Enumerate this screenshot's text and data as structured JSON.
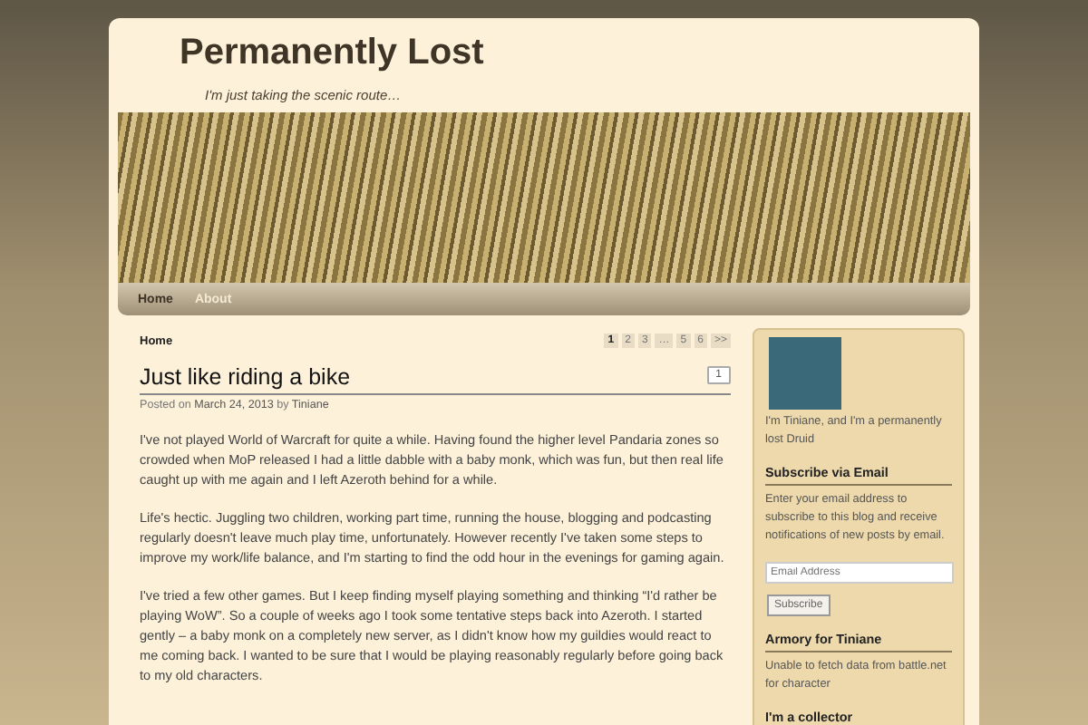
{
  "site": {
    "title": "Permanently Lost",
    "tagline": "I'm just taking the scenic route…"
  },
  "nav": [
    {
      "label": "Home",
      "selected": true
    },
    {
      "label": "About",
      "selected": false
    }
  ],
  "breadcrumb": "Home",
  "pagination": [
    {
      "label": "1",
      "selected": true
    },
    {
      "label": "2",
      "selected": false
    },
    {
      "label": "3",
      "selected": false
    },
    {
      "label": "…",
      "selected": false
    },
    {
      "label": "5",
      "selected": false
    },
    {
      "label": "6",
      "selected": false
    },
    {
      "label": ">>",
      "selected": false
    }
  ],
  "post": {
    "title": "Just like riding a bike",
    "comments": "1",
    "posted_prefix": "Posted on",
    "date": "March 24, 2013",
    "by": "by",
    "author": "Tiniane",
    "paragraphs": [
      "I've not played World of Warcraft for quite a while. Having found the higher level Pandaria zones so crowded when MoP released I had a little dabble with a baby monk, which was fun, but then real life caught up with me again and I left Azeroth behind for a while.",
      "Life's hectic. Juggling two children, working part time, running the house, blogging and podcasting regularly doesn't leave much play time, unfortunately. However recently I've taken some steps to improve my work/life balance, and I'm starting to find the odd hour in the evenings for gaming again.",
      "I've tried a few other games. But I keep finding myself playing something and thinking “I'd rather be playing WoW”. So a couple of weeks ago I took some tentative steps back into Azeroth. I started gently – a baby monk on a completely new server, as I didn't know how my guildies would react to me coming back. I wanted to be sure that I would be playing reasonably regularly before going back to my old characters."
    ]
  },
  "sidebar": {
    "bio": "I'm Tiniane, and I'm a permanently lost Druid",
    "subscribe": {
      "heading": "Subscribe via Email",
      "text": "Enter your email address to subscribe to this blog and receive notifications of new posts by email.",
      "placeholder": "Email Address",
      "button": "Subscribe"
    },
    "armory": {
      "heading": "Armory for Tiniane",
      "text": "Unable to fetch data from battle.net for character"
    },
    "next_heading": "I'm a collector"
  }
}
